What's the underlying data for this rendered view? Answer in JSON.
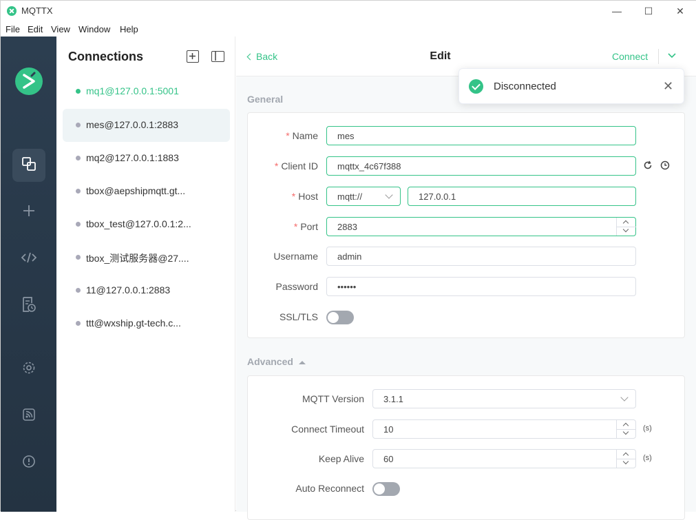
{
  "window": {
    "title": "MQTTX",
    "minimize": "—",
    "maximize": "☐",
    "close": "✕"
  },
  "menu": [
    "File",
    "Edit",
    "View",
    "Window",
    "Help"
  ],
  "connections": {
    "title": "Connections",
    "items": [
      {
        "label": "mq1@127.0.0.1:5001",
        "status": "online"
      },
      {
        "label": "mes@127.0.0.1:2883",
        "status": "offline",
        "active": true
      },
      {
        "label": "mq2@127.0.0.1:1883",
        "status": "offline"
      },
      {
        "label": "tbox@aepshipmqtt.gt...",
        "status": "offline"
      },
      {
        "label": "tbox_test@127.0.0.1:2...",
        "status": "offline"
      },
      {
        "label": "tbox_测试服务器@27....",
        "status": "offline"
      },
      {
        "label": "11@127.0.0.1:2883",
        "status": "offline"
      },
      {
        "label": "ttt@wxship.gt-tech.c...",
        "status": "offline"
      }
    ]
  },
  "topbar": {
    "back": "Back",
    "title": "Edit",
    "connect": "Connect"
  },
  "toast": {
    "text": "Disconnected",
    "close": "✕"
  },
  "general": {
    "title": "General",
    "name": {
      "label": "Name",
      "value": "mes"
    },
    "client_id": {
      "label": "Client ID",
      "value": "mqttx_4c67f388"
    },
    "host": {
      "label": "Host",
      "protocol": "mqtt://",
      "value": "127.0.0.1"
    },
    "port": {
      "label": "Port",
      "value": "2883"
    },
    "username": {
      "label": "Username",
      "value": "admin"
    },
    "password": {
      "label": "Password",
      "value": "••••••"
    },
    "ssl": {
      "label": "SSL/TLS",
      "on": false
    }
  },
  "advanced": {
    "title": "Advanced",
    "mqtt_version": {
      "label": "MQTT Version",
      "value": "3.1.1"
    },
    "connect_timeout": {
      "label": "Connect Timeout",
      "value": "10",
      "unit": "(s)"
    },
    "keep_alive": {
      "label": "Keep Alive",
      "value": "60",
      "unit": "(s)"
    },
    "auto_reconnect": {
      "label": "Auto Reconnect",
      "on": false
    }
  },
  "colors": {
    "accent": "#34c388",
    "nav_bg": "#2c3e50",
    "required": "#f56c6c"
  }
}
